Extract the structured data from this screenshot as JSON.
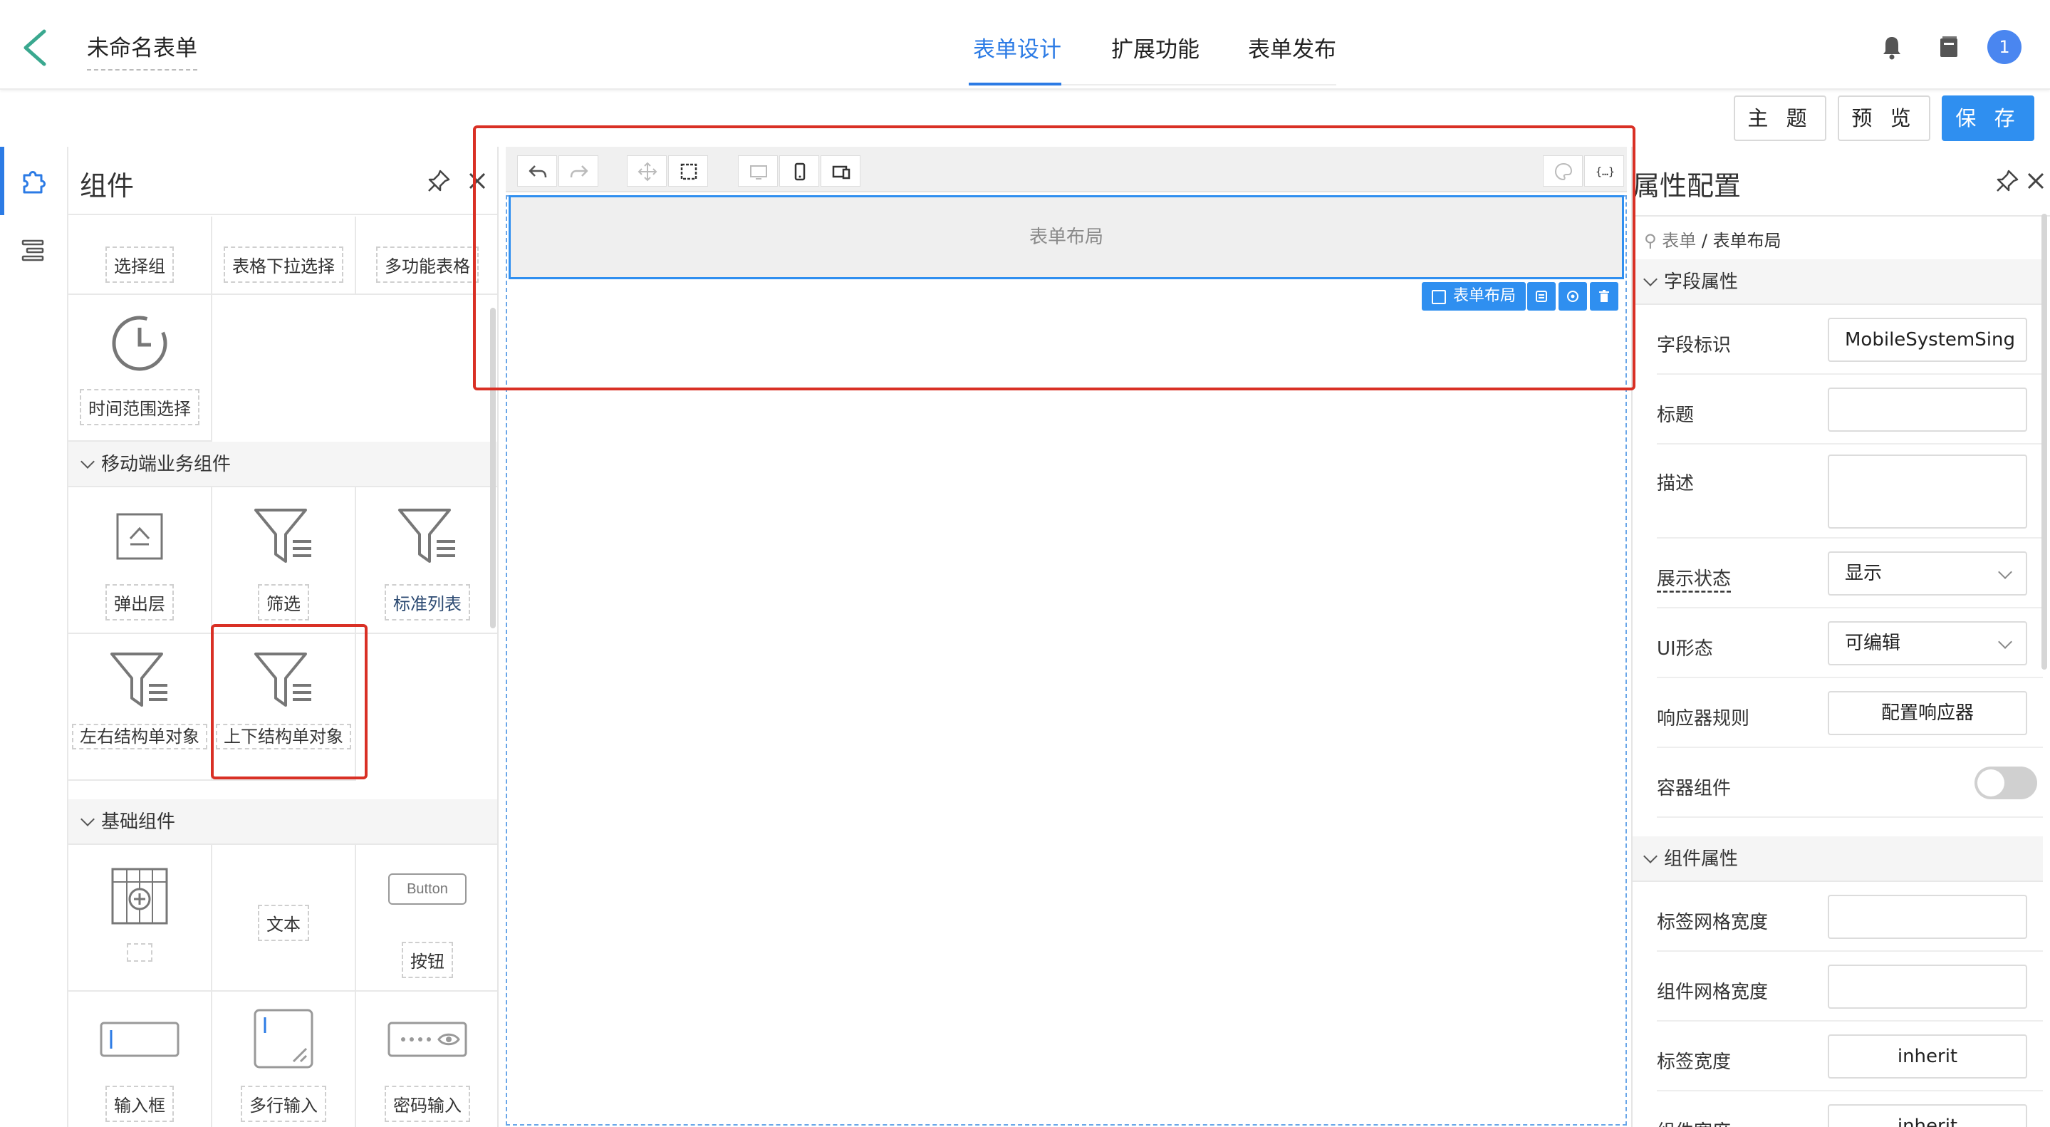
{
  "header": {
    "form_title": "未命名表单",
    "tabs": [
      {
        "label": "表单设计",
        "active": true
      },
      {
        "label": "扩展功能",
        "active": false
      },
      {
        "label": "表单发布",
        "active": false
      }
    ],
    "avatar_text": "1",
    "icons": [
      "back-arrow-icon",
      "bell-icon",
      "archive-icon"
    ]
  },
  "actions": {
    "theme": "主 题",
    "preview": "预 览",
    "save": "保 存"
  },
  "components_panel": {
    "title": "组件",
    "top_items": [
      {
        "label": "选择组"
      },
      {
        "label": "表格下拉选择"
      },
      {
        "label": "多功能表格"
      },
      {
        "label": "时间范围选择",
        "icon": "clock-icon"
      }
    ],
    "mobile_section": {
      "title": "移动端业务组件",
      "items": [
        {
          "label": "弹出层",
          "icon": "popup-icon"
        },
        {
          "label": "筛选",
          "icon": "filter-icon"
        },
        {
          "label": "标准列表",
          "icon": "filter-icon"
        },
        {
          "label": "左右结构单对象",
          "icon": "filter-icon"
        },
        {
          "label": "上下结构单对象",
          "icon": "filter-icon",
          "highlighted": true
        }
      ]
    },
    "basic_section": {
      "title": "基础组件",
      "items": [
        {
          "label": "",
          "icon": "grid-layout-icon"
        },
        {
          "label": "文本"
        },
        {
          "label": "按钮",
          "preview_text": "Button"
        },
        {
          "label": "输入框",
          "icon": "input-icon"
        },
        {
          "label": "多行输入",
          "icon": "textarea-icon"
        },
        {
          "label": "密码输入",
          "icon": "password-icon"
        }
      ]
    }
  },
  "canvas": {
    "layout_block_text": "表单布局",
    "selected_tag": "表单布局",
    "toolbar_icons": [
      "undo-icon",
      "redo-icon",
      "move-icon",
      "select-area-icon",
      "desktop-icon",
      "mobile-icon",
      "tablet-icon",
      "palette-icon",
      "code-icon"
    ]
  },
  "properties": {
    "title": "属性配置",
    "breadcrumb_root": "表单",
    "breadcrumb_separator": "/",
    "breadcrumb_current": "表单布局",
    "field_section": "字段属性",
    "rows": [
      {
        "label": "字段标识",
        "value": "MobileSystemSing"
      },
      {
        "label": "标题",
        "value": ""
      },
      {
        "label": "描述",
        "value": ""
      },
      {
        "label": "展示状态",
        "value": "显示"
      },
      {
        "label": "UI形态",
        "value": "可编辑"
      },
      {
        "label": "响应器规则",
        "value": "配置响应器"
      },
      {
        "label": "容器组件",
        "toggle": false
      }
    ],
    "component_section": "组件属性",
    "component_rows": [
      {
        "label": "标签网格宽度",
        "value": ""
      },
      {
        "label": "组件网格宽度",
        "value": ""
      },
      {
        "label": "标签宽度",
        "value": "inherit"
      },
      {
        "label": "组件宽度",
        "value": "inherit"
      }
    ]
  },
  "colors": {
    "accent": "#2c7be5",
    "primary_button": "#2f8ff0",
    "highlight_box": "#d93025"
  }
}
